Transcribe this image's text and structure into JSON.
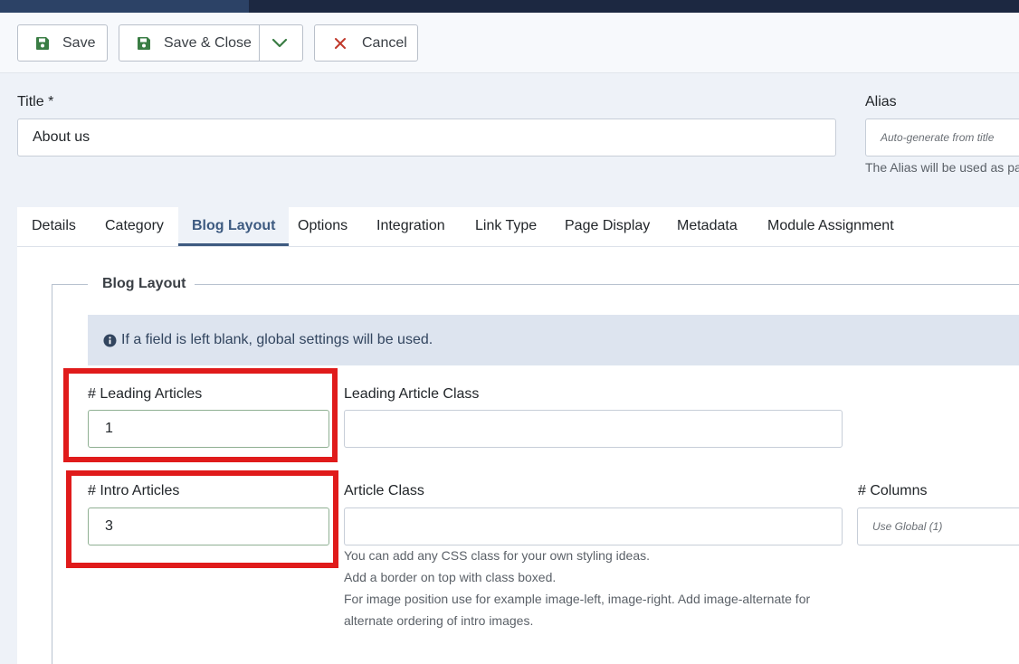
{
  "toolbar": {
    "save_label": "Save",
    "save_close_label": "Save & Close",
    "cancel_label": "Cancel"
  },
  "form": {
    "title_label": "Title *",
    "title_value": "About us",
    "alias_label": "Alias",
    "alias_placeholder": "Auto-generate from title",
    "alias_hint": "The Alias will be used as pa"
  },
  "tabs": [
    {
      "label": "Details"
    },
    {
      "label": "Category"
    },
    {
      "label": "Blog Layout"
    },
    {
      "label": "Options"
    },
    {
      "label": "Integration"
    },
    {
      "label": "Link Type"
    },
    {
      "label": "Page Display"
    },
    {
      "label": "Metadata"
    },
    {
      "label": "Module Assignment"
    }
  ],
  "blog_layout": {
    "legend": "Blog Layout",
    "info_text": "If a field is left blank, global settings will be used.",
    "leading_articles_label": "# Leading Articles",
    "leading_articles_value": "1",
    "leading_article_class_label": "Leading Article Class",
    "leading_article_class_value": "",
    "intro_articles_label": "# Intro Articles",
    "intro_articles_value": "3",
    "article_class_label": "Article Class",
    "article_class_value": "",
    "columns_label": "# Columns",
    "columns_value": "Use Global (1)",
    "help_lines": [
      "You can add any CSS class for your own styling ideas.",
      "Add a border on top with class boxed.",
      "For image position use for example image-left, image-right. Add image-alternate for",
      "alternate ordering of intro images."
    ]
  },
  "colors": {
    "accent": "#3d5a80",
    "highlight": "#e01b1b",
    "save_icon": "#3a7d44",
    "cancel_icon": "#c0392b"
  },
  "icons": {
    "save": "floppy-disk-icon",
    "cancel": "close-icon",
    "dropdown": "chevron-down-icon",
    "info": "info-circle-icon"
  }
}
